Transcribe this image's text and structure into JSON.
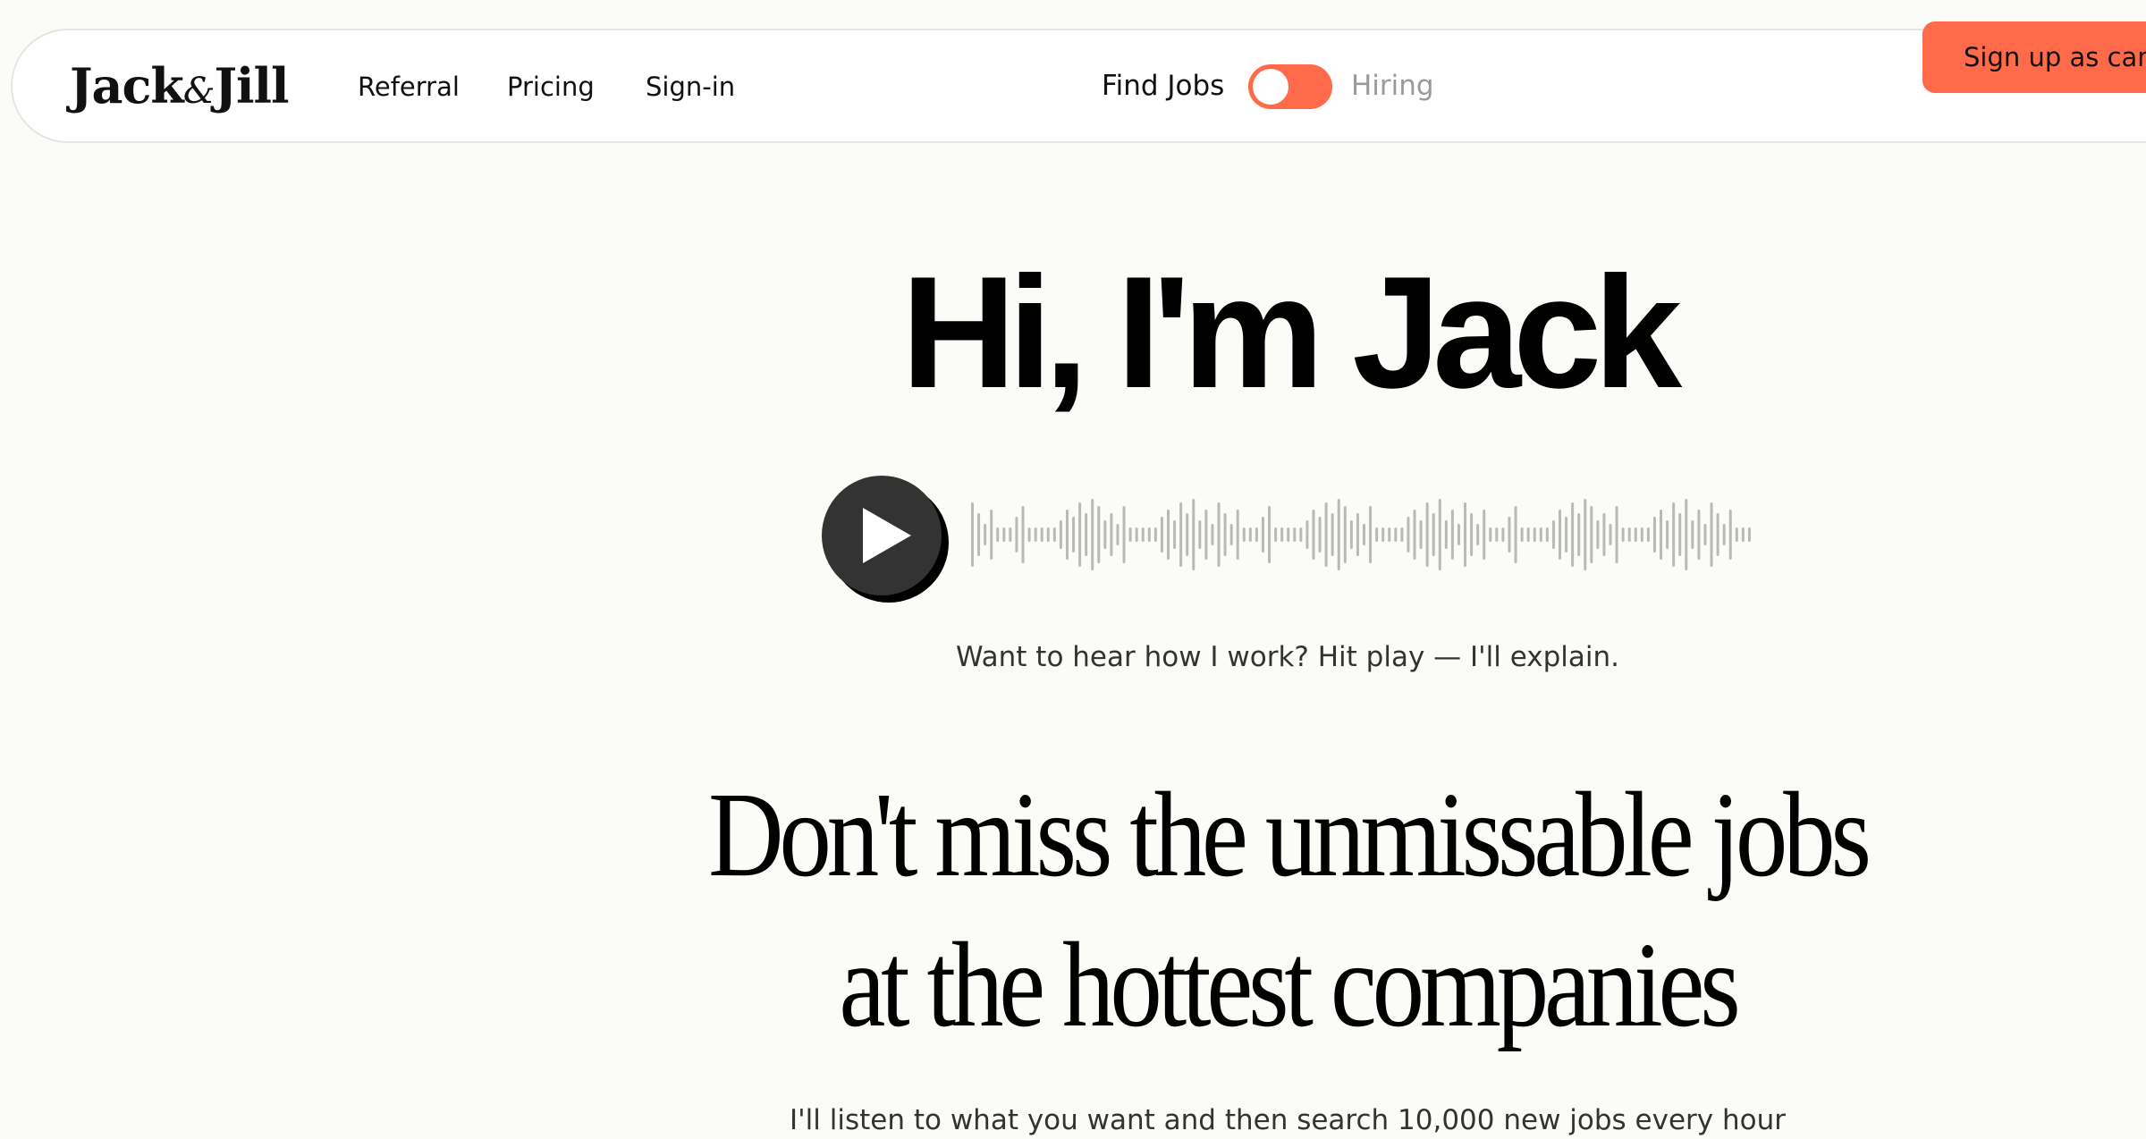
{
  "nav": {
    "logo": {
      "part1": "Jack",
      "amp": "&",
      "part2": "Jill"
    },
    "links": [
      "Referral",
      "Pricing",
      "Sign-in"
    ],
    "mode_toggle": {
      "left_label": "Find Jobs",
      "right_label": "Hiring"
    },
    "signup_label": "Sign up as candidate"
  },
  "hero": {
    "title": "Hi, I'm Jack",
    "audio_hint": "Want to hear how I work? Hit play — I'll explain.",
    "headline_line1": "Don't miss the unmissable jobs",
    "headline_line2": "at the hottest companies",
    "subtext": "I'll listen to what you want and then search 10,000 new jobs every hour"
  },
  "colors": {
    "accent": "#ff6b4a",
    "background": "#fbfbf7",
    "waveform": "#b9b9b9"
  },
  "icons": {
    "play": "play-icon",
    "waveform": "audio-waveform-icon"
  }
}
